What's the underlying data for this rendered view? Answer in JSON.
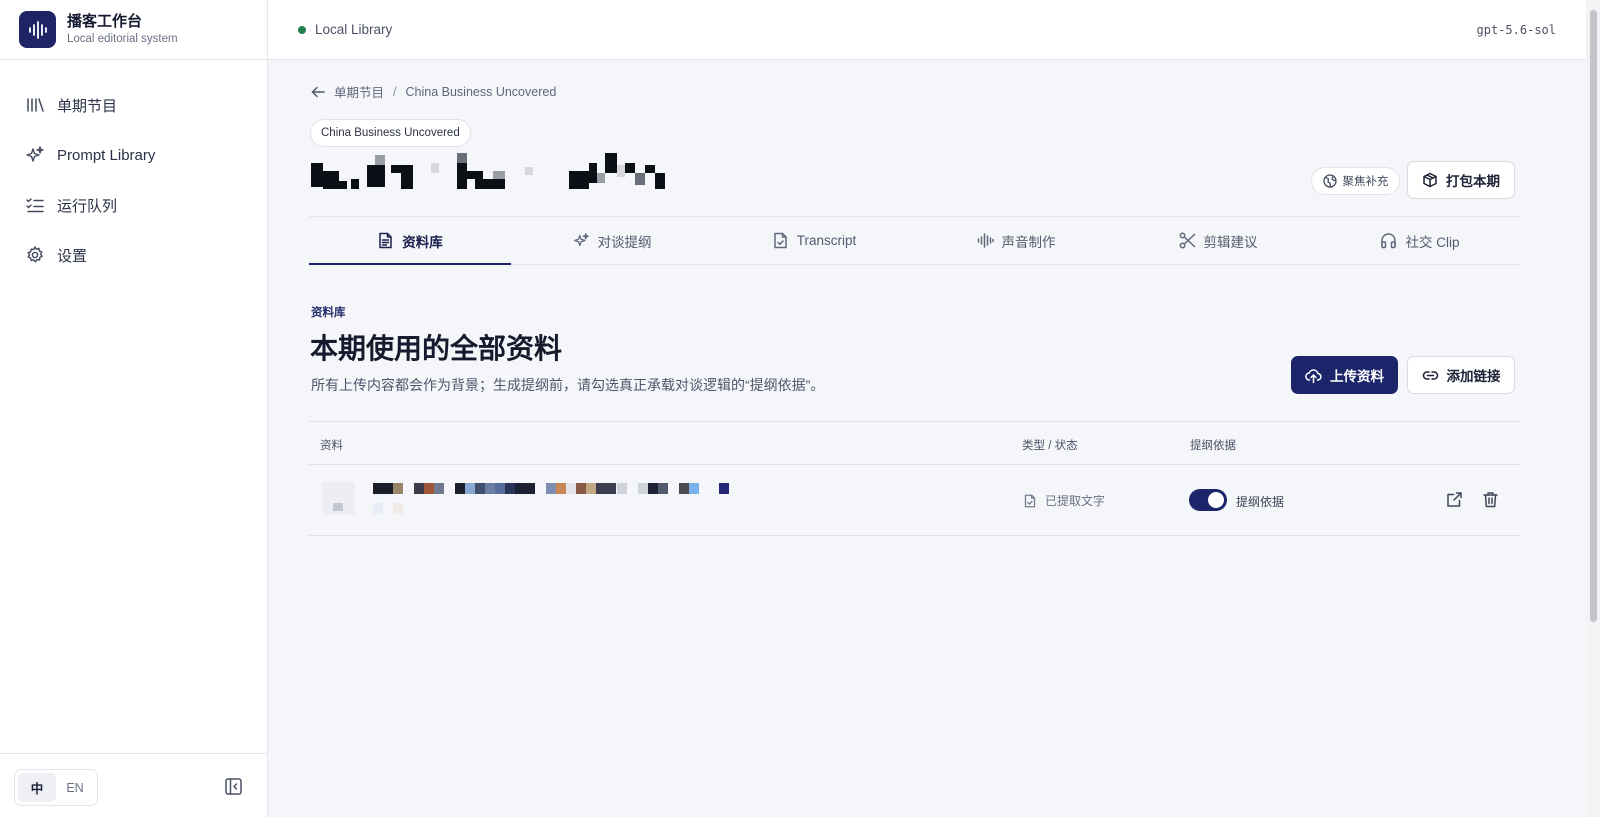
{
  "app": {
    "name": "播客工作台",
    "subtitle": "Local editorial system"
  },
  "sidebar": {
    "items": [
      {
        "label": "单期节目",
        "icon": "library-icon"
      },
      {
        "label": "Prompt Library",
        "icon": "sparkles-icon"
      },
      {
        "label": "运行队列",
        "icon": "list-checks-icon"
      },
      {
        "label": "设置",
        "icon": "gear-icon"
      }
    ],
    "lang": {
      "zh": "中",
      "en": "EN",
      "active": "zh"
    }
  },
  "topbar": {
    "status": "Local Library",
    "model": "gpt-5.6-sol"
  },
  "breadcrumb": {
    "parent": "单期节目",
    "separator": "/",
    "current": "China Business Uncovered"
  },
  "episode": {
    "show_badge": "China Business Uncovered"
  },
  "actions": {
    "focus_label": "聚焦补充",
    "package_label": "打包本期",
    "upload_label": "上传资料",
    "add_link_label": "添加链接"
  },
  "tabs": [
    {
      "label": "资料库",
      "icon": "file-text-icon",
      "active": true
    },
    {
      "label": "对谈提纲",
      "icon": "sparkles-icon",
      "active": false
    },
    {
      "label": "Transcript",
      "icon": "file-check-icon",
      "active": false
    },
    {
      "label": "声音制作",
      "icon": "audio-wave-icon",
      "active": false
    },
    {
      "label": "剪辑建议",
      "icon": "scissors-icon",
      "active": false
    },
    {
      "label": "社交 Clip",
      "icon": "headphones-icon",
      "active": false
    }
  ],
  "section": {
    "label": "资料库",
    "title": "本期使用的全部资料",
    "description": "所有上传内容都会作为背景；生成提纲前，请勾选真正承载对谈逻辑的“提纲依据”。"
  },
  "table": {
    "columns": [
      "资料",
      "类型 / 状态",
      "提纲依据"
    ],
    "rows": [
      {
        "status": "已提取文字",
        "outline_basis_on": true,
        "outline_basis_label": "提纲依据"
      }
    ]
  },
  "colors": {
    "primary": "#1c246a",
    "status_dot": "#22804f"
  }
}
